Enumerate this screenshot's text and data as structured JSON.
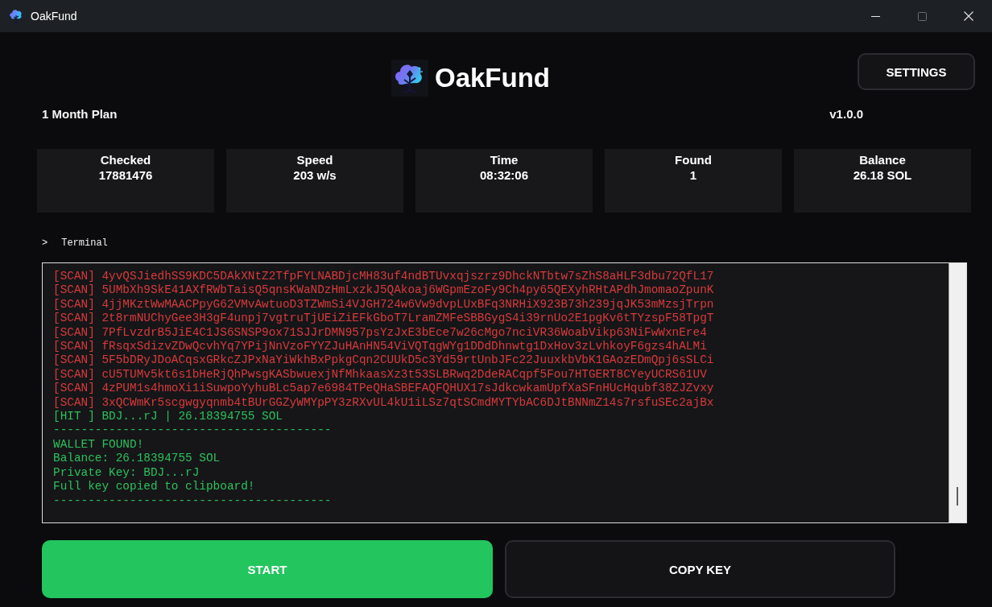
{
  "window": {
    "title": "OakFund",
    "controls": [
      {
        "kind": "minimize",
        "disabled": false
      },
      {
        "kind": "maximize",
        "disabled": true
      },
      {
        "kind": "close",
        "disabled": false
      }
    ]
  },
  "header": {
    "brand": "OakFund",
    "settings_button": "SETTINGS",
    "plan": "1 Month Plan",
    "version": "v1.0.0"
  },
  "stats": [
    {
      "label": "Checked",
      "value": "17881476"
    },
    {
      "label": "Speed",
      "value": "203 w/s"
    },
    {
      "label": "Time",
      "value": "08:32:06"
    },
    {
      "label": "Found",
      "value": "1"
    },
    {
      "label": "Balance",
      "value": "26.18 SOL"
    }
  ],
  "terminal": {
    "prompt": ">",
    "label": "Terminal",
    "lines": [
      {
        "kind": "scan",
        "text": "[SCAN] 4yvQSJiedhSS9KDC5DAkXNtZ2TfpFYLNABDjcMH83uf4ndBTUvxqjszrz9DhckNTbtw7sZhS8aHLF3dbu72QfL17"
      },
      {
        "kind": "scan",
        "text": "[SCAN] 5UMbXh9SkE41AXfRWbTaisQ5qnsKWaNDzHmLxzkJ5QAkoaj6WGpmEzoFy9Ch4py65QEXyhRHtAPdhJmomaoZpunK"
      },
      {
        "kind": "scan",
        "text": "[SCAN] 4jjMKztWwMAACPpyG62VMvAwtuoD3TZWmSi4VJGH724w6Vw9dvpLUxBFq3NRHiX923B73h239jqJK53mMzsjTrpn"
      },
      {
        "kind": "scan",
        "text": "[SCAN] 2t8rmNUChyGee3H3gF4unpj7vgtruTjUEiZiEFkGboT7LramZMFeSBBGygS4i39rnUo2E1pgKv6tTYzspF58TpgT"
      },
      {
        "kind": "scan",
        "text": "[SCAN] 7PfLvzdrB5JiE4C1JS6SNSP9ox71SJJrDMN957psYzJxE3bEce7w26cMgo7nciVR36WoabVikp63NiFwWxnEre4"
      },
      {
        "kind": "scan",
        "text": "[SCAN] fRsqxSdizvZDwQcvhYq7YPijNnVzoFYYZJuHAnHN54ViVQTqgWYg1DDdDhnwtg1DxHov3zLvhkoyF6gzs4hALMi"
      },
      {
        "kind": "scan",
        "text": "[SCAN] 5F5bDRyJDoACqsxGRkcZJPxNaYiWkhBxPpkgCqn2CUUkD5c3Yd59rtUnbJFc22JuuxkbVbK1GAozEDmQpj6sSLCi"
      },
      {
        "kind": "scan",
        "text": "[SCAN] cU5TUMv5kt6s1bHeRjQhPwsgKASbwuexjNfMhkaasXz3t53SLBRwq2DdeRACqpf5Fou7HTGERT8CYeyUCRS61UV"
      },
      {
        "kind": "scan",
        "text": "[SCAN] 4zPUM1s4hmoXi1iSuwpoYyhuBLc5ap7e6984TPeQHaSBEFAQFQHUX17sJdkcwkamUpfXaSFnHUcHqubf38ZJZvxy"
      },
      {
        "kind": "scan",
        "text": "[SCAN] 3xQCWmKr5scgwgyqnmb4tBUrGGZyWMYpPY3zRXvUL4kU1iLSz7qtSCmdMYTYbAC6DJtBNNmZ14s7rsfuSEc2ajBx"
      },
      {
        "kind": "hit",
        "text": "[HIT ] BDJ...rJ | 26.18394755 SOL"
      },
      {
        "kind": "divider",
        "text": "----------------------------------------"
      },
      {
        "kind": "message",
        "text": "WALLET FOUND!"
      },
      {
        "kind": "message",
        "text": "Balance: 26.18394755 SOL"
      },
      {
        "kind": "message",
        "text": "Private Key: BDJ...rJ"
      },
      {
        "kind": "message",
        "text": "Full key copied to clipboard!"
      },
      {
        "kind": "divider",
        "text": "----------------------------------------"
      }
    ]
  },
  "buttons": [
    {
      "kind": "primary",
      "label": "START"
    },
    {
      "kind": "secondary",
      "label": "COPY KEY"
    }
  ]
}
